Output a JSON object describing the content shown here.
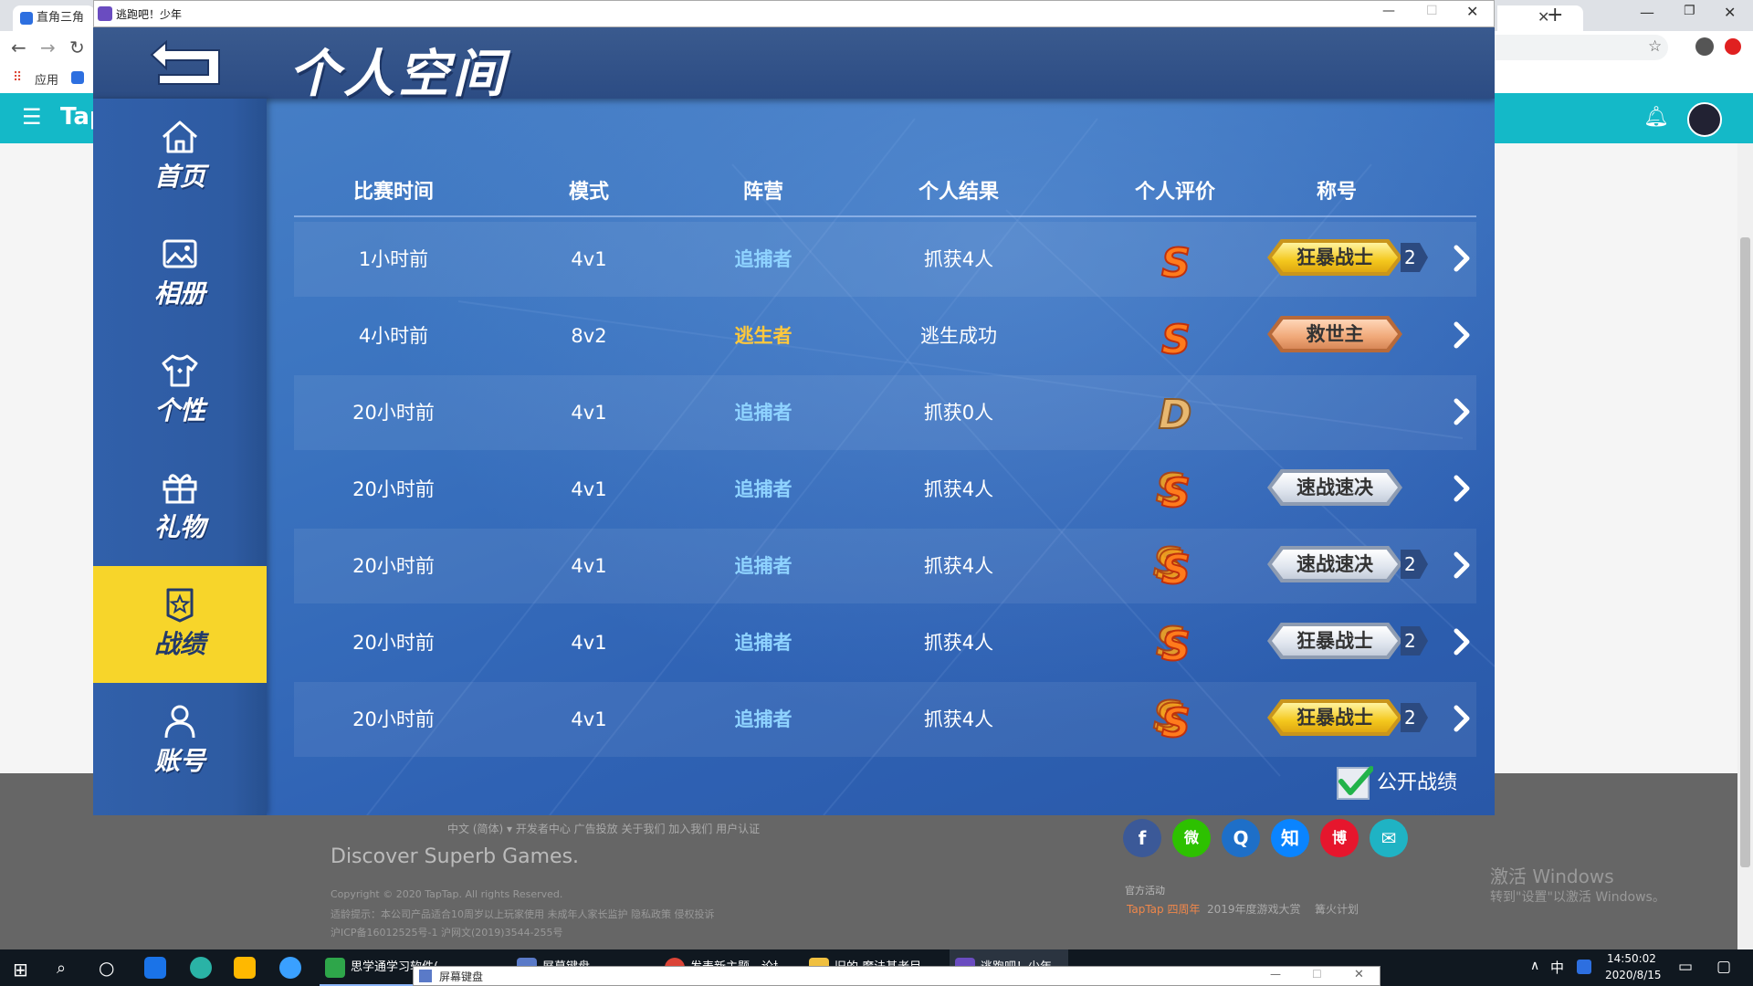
{
  "browser": {
    "tabs": [
      {
        "title": "直角三角形"
      },
      {
        "title": "逃跑吧！少年"
      }
    ],
    "bookmark_apps": "应用",
    "taptap_logo": "Tap"
  },
  "game": {
    "window_title": "逃跑吧！少年",
    "page_title": "个人空间",
    "nav": [
      {
        "label": "首页",
        "icon": "home-icon"
      },
      {
        "label": "相册",
        "icon": "image-icon"
      },
      {
        "label": "个性",
        "icon": "shirt-icon"
      },
      {
        "label": "礼物",
        "icon": "gift-icon"
      },
      {
        "label": "战绩",
        "icon": "badge-icon",
        "active": true
      },
      {
        "label": "账号",
        "icon": "user-icon"
      }
    ],
    "columns": [
      "比赛时间",
      "模式",
      "阵营",
      "个人结果",
      "个人评价",
      "称号"
    ],
    "rows": [
      {
        "time": "1小时前",
        "mode": "4v1",
        "camp": "追捕者",
        "result": "抓获4人",
        "grade": "S",
        "title": "狂暴战士",
        "title_style": "gold",
        "count": "2"
      },
      {
        "time": "4小时前",
        "mode": "8v2",
        "camp": "逃生者",
        "result": "逃生成功",
        "grade": "S",
        "title": "救世主",
        "title_style": "bronze",
        "count": ""
      },
      {
        "time": "20小时前",
        "mode": "4v1",
        "camp": "追捕者",
        "result": "抓获0人",
        "grade": "D",
        "title": "",
        "title_style": "",
        "count": ""
      },
      {
        "time": "20小时前",
        "mode": "4v1",
        "camp": "追捕者",
        "result": "抓获4人",
        "grade": "SS",
        "title": "速战速决",
        "title_style": "silver",
        "count": ""
      },
      {
        "time": "20小时前",
        "mode": "4v1",
        "camp": "追捕者",
        "result": "抓获4人",
        "grade": "SSS",
        "title": "速战速决",
        "title_style": "silver",
        "count": "2"
      },
      {
        "time": "20小时前",
        "mode": "4v1",
        "camp": "追捕者",
        "result": "抓获4人",
        "grade": "SS",
        "title": "狂暴战士",
        "title_style": "silver",
        "count": "2"
      },
      {
        "time": "20小时前",
        "mode": "4v1",
        "camp": "追捕者",
        "result": "抓获4人",
        "grade": "SSS",
        "title": "狂暴战士",
        "title_style": "gold",
        "count": "2"
      }
    ],
    "public_record_label": "公开战绩",
    "public_record_checked": true,
    "colors": {
      "hunter": "#8fd3ff",
      "survivor": "#ffc83c",
      "active_nav": "#f7d52a"
    }
  },
  "footer": {
    "links": "中文 (简体) ▾   开发者中心   广告投放   关于我们   加入我们   用户认证",
    "tagline": "Discover Superb Games.",
    "copyright": "Copyright © 2020 TapTap. All rights Reserved.",
    "notice": "适龄提示：本公司产品适合10周岁以上玩家使用  未成年人家长监护  隐私政策  侵权投诉",
    "icp": "沪ICP备16012525号-1   沪网文(2019)3544-255号",
    "official_title": "官方活动",
    "activities": [
      "TapTap 四周年",
      "2019年度游戏大赏",
      "篝火计划"
    ],
    "social": [
      "f",
      "微",
      "Q",
      "知",
      "博",
      "✉"
    ]
  },
  "taskbar": {
    "apps": [
      "思学通学习软件(正",
      "屏幕键盘",
      "发表新主题 - 论坛",
      "旧的 魔法基老目录",
      "逃跑吧！少年"
    ],
    "ime": "中",
    "time": "14:50:02",
    "date": "2020/8/15",
    "osk_title": "屏幕键盘"
  },
  "watermark": {
    "title": "激活 Windows",
    "subtitle": "转到\"设置\"以激活 Windows。"
  }
}
